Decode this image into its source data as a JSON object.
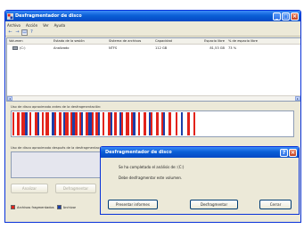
{
  "window": {
    "title": "Desfragmentador de disco",
    "menu": [
      "Archivo",
      "Acción",
      "Ver",
      "Ayuda"
    ],
    "toolbar_icons": [
      "back-arrow-icon",
      "forward-arrow-icon",
      "view-icon",
      "help-icon"
    ]
  },
  "volumes": {
    "columns": [
      "Volumen",
      "Estado de la sesión",
      "Sistema de archivos",
      "Capacidad",
      "Espacio libre",
      "% de espacio libre"
    ],
    "rows": [
      {
        "volume": "(C:)",
        "status": "Analizado",
        "fs": "NTFS",
        "capacity": "112 GB",
        "free": "81,53 GB",
        "pct": "73 %"
      }
    ]
  },
  "analysis": {
    "before_label": "Uso de disco aproximado antes de la desfragmentación:",
    "after_label": "Uso de disco aproximado después de la desfragmentación:"
  },
  "buttons": {
    "analyze": "Analizar",
    "defrag": "Defragmentar"
  },
  "legend": {
    "fragmented": "Archivos fragmentados",
    "contiguous": "Archivos contiguos",
    "fragmented_color": "#e2231a",
    "contiguous_color": "#1b3fa8"
  },
  "dialog": {
    "title": "Desfragmentador de disco",
    "line1": "Se ha completado el análisis de: (C:)",
    "line2": "Debe desfragmentar este volumen.",
    "btn_report": "Presentar informes",
    "btn_defrag": "Desfragmentar",
    "btn_close": "Cerrar"
  },
  "colors": {
    "title_blue": "#0a5fd6",
    "window_bg": "#ece9d8",
    "free_space": "#ffffff"
  }
}
